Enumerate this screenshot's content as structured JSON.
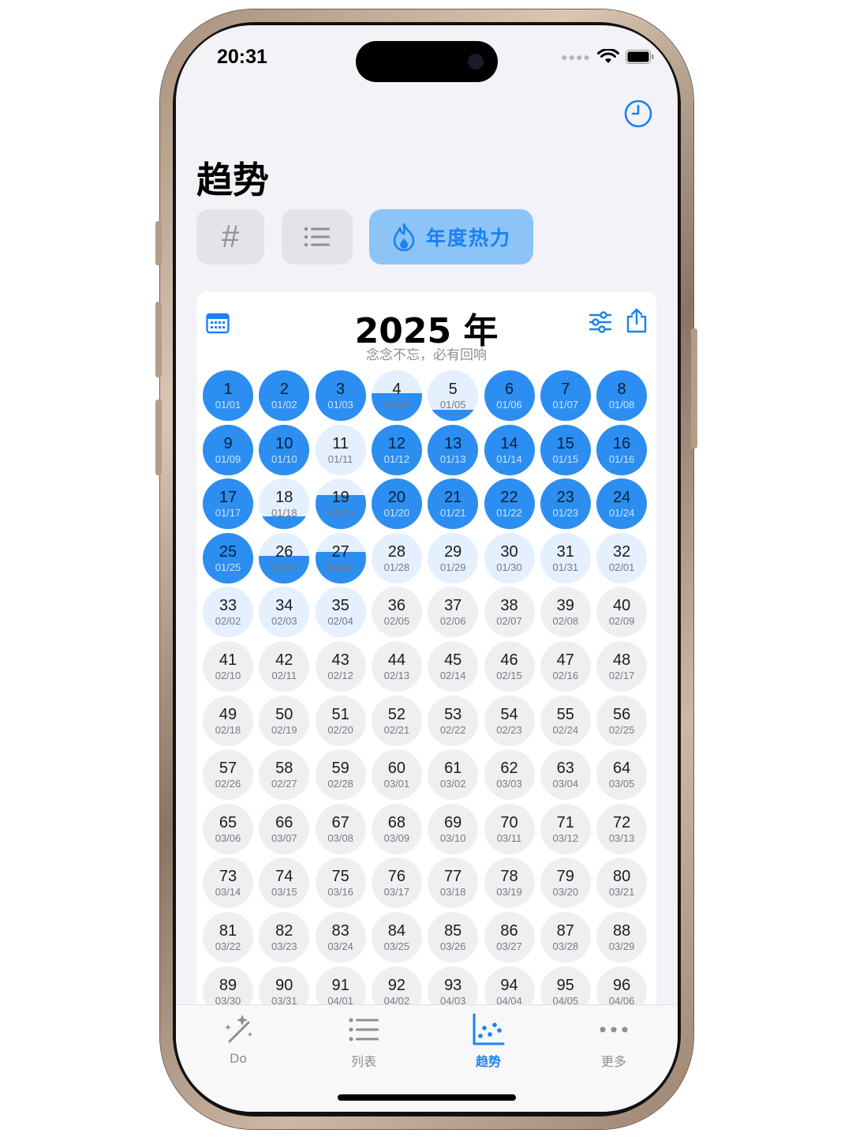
{
  "status": {
    "time": "20:31"
  },
  "page": {
    "title": "趋势"
  },
  "segments": {
    "hash_label": "#",
    "heat_label": "年度热力"
  },
  "card": {
    "year": "2025 年",
    "subtitle": "念念不忘，必有回响"
  },
  "colors": {
    "accent": "#2b8ef0",
    "accent_light": "#e4f0fd",
    "segment_active": "#8cc4f7",
    "future": "#efeff2"
  },
  "days": [
    {
      "n": "1",
      "d": "01/01",
      "fill": 1
    },
    {
      "n": "2",
      "d": "01/02",
      "fill": 1
    },
    {
      "n": "3",
      "d": "01/03",
      "fill": 1
    },
    {
      "n": "4",
      "d": "01/04",
      "fill": 0.55
    },
    {
      "n": "5",
      "d": "01/05",
      "fill": 0.22
    },
    {
      "n": "6",
      "d": "01/06",
      "fill": 1
    },
    {
      "n": "7",
      "d": "01/07",
      "fill": 1
    },
    {
      "n": "8",
      "d": "01/08",
      "fill": 1
    },
    {
      "n": "9",
      "d": "01/09",
      "fill": 1
    },
    {
      "n": "10",
      "d": "01/10",
      "fill": 1
    },
    {
      "n": "11",
      "d": "01/11",
      "fill": 0
    },
    {
      "n": "12",
      "d": "01/12",
      "fill": 1
    },
    {
      "n": "13",
      "d": "01/13",
      "fill": 1
    },
    {
      "n": "14",
      "d": "01/14",
      "fill": 1
    },
    {
      "n": "15",
      "d": "01/15",
      "fill": 1
    },
    {
      "n": "16",
      "d": "01/16",
      "fill": 1
    },
    {
      "n": "17",
      "d": "01/17",
      "fill": 1
    },
    {
      "n": "18",
      "d": "01/18",
      "fill": 0.25
    },
    {
      "n": "19",
      "d": "01/19",
      "fill": 0.68
    },
    {
      "n": "20",
      "d": "01/20",
      "fill": 1
    },
    {
      "n": "21",
      "d": "01/21",
      "fill": 1
    },
    {
      "n": "22",
      "d": "01/22",
      "fill": 1
    },
    {
      "n": "23",
      "d": "01/23",
      "fill": 1
    },
    {
      "n": "24",
      "d": "01/24",
      "fill": 1
    },
    {
      "n": "25",
      "d": "01/25",
      "fill": 1
    },
    {
      "n": "26",
      "d": "01/26",
      "fill": 0.55
    },
    {
      "n": "27",
      "d": "01/27",
      "fill": 0.62
    },
    {
      "n": "28",
      "d": "01/28",
      "fill": 0
    },
    {
      "n": "29",
      "d": "01/29",
      "fill": 0
    },
    {
      "n": "30",
      "d": "01/30",
      "fill": 0
    },
    {
      "n": "31",
      "d": "01/31",
      "fill": 0
    },
    {
      "n": "32",
      "d": "02/01",
      "fill": 0
    },
    {
      "n": "33",
      "d": "02/02",
      "fill": 0
    },
    {
      "n": "34",
      "d": "02/03",
      "fill": 0
    },
    {
      "n": "35",
      "d": "02/04",
      "fill": 0
    },
    {
      "n": "36",
      "d": "02/05"
    },
    {
      "n": "37",
      "d": "02/06"
    },
    {
      "n": "38",
      "d": "02/07"
    },
    {
      "n": "39",
      "d": "02/08"
    },
    {
      "n": "40",
      "d": "02/09"
    },
    {
      "n": "41",
      "d": "02/10"
    },
    {
      "n": "42",
      "d": "02/11"
    },
    {
      "n": "43",
      "d": "02/12"
    },
    {
      "n": "44",
      "d": "02/13"
    },
    {
      "n": "45",
      "d": "02/14"
    },
    {
      "n": "46",
      "d": "02/15"
    },
    {
      "n": "47",
      "d": "02/16"
    },
    {
      "n": "48",
      "d": "02/17"
    },
    {
      "n": "49",
      "d": "02/18"
    },
    {
      "n": "50",
      "d": "02/19"
    },
    {
      "n": "51",
      "d": "02/20"
    },
    {
      "n": "52",
      "d": "02/21"
    },
    {
      "n": "53",
      "d": "02/22"
    },
    {
      "n": "54",
      "d": "02/23"
    },
    {
      "n": "55",
      "d": "02/24"
    },
    {
      "n": "56",
      "d": "02/25"
    },
    {
      "n": "57",
      "d": "02/26"
    },
    {
      "n": "58",
      "d": "02/27"
    },
    {
      "n": "59",
      "d": "02/28"
    },
    {
      "n": "60",
      "d": "03/01"
    },
    {
      "n": "61",
      "d": "03/02"
    },
    {
      "n": "62",
      "d": "03/03"
    },
    {
      "n": "63",
      "d": "03/04"
    },
    {
      "n": "64",
      "d": "03/05"
    },
    {
      "n": "65",
      "d": "03/06"
    },
    {
      "n": "66",
      "d": "03/07"
    },
    {
      "n": "67",
      "d": "03/08"
    },
    {
      "n": "68",
      "d": "03/09"
    },
    {
      "n": "69",
      "d": "03/10"
    },
    {
      "n": "70",
      "d": "03/11"
    },
    {
      "n": "71",
      "d": "03/12"
    },
    {
      "n": "72",
      "d": "03/13"
    },
    {
      "n": "73",
      "d": "03/14"
    },
    {
      "n": "74",
      "d": "03/15"
    },
    {
      "n": "75",
      "d": "03/16"
    },
    {
      "n": "76",
      "d": "03/17"
    },
    {
      "n": "77",
      "d": "03/18"
    },
    {
      "n": "78",
      "d": "03/19"
    },
    {
      "n": "79",
      "d": "03/20"
    },
    {
      "n": "80",
      "d": "03/21"
    },
    {
      "n": "81",
      "d": "03/22"
    },
    {
      "n": "82",
      "d": "03/23"
    },
    {
      "n": "83",
      "d": "03/24"
    },
    {
      "n": "84",
      "d": "03/25"
    },
    {
      "n": "85",
      "d": "03/26"
    },
    {
      "n": "86",
      "d": "03/27"
    },
    {
      "n": "87",
      "d": "03/28"
    },
    {
      "n": "88",
      "d": "03/29"
    },
    {
      "n": "89",
      "d": "03/30"
    },
    {
      "n": "90",
      "d": "03/31"
    },
    {
      "n": "91",
      "d": "04/01"
    },
    {
      "n": "92",
      "d": "04/02"
    },
    {
      "n": "93",
      "d": "04/03"
    },
    {
      "n": "94",
      "d": "04/04"
    },
    {
      "n": "95",
      "d": "04/05"
    },
    {
      "n": "96",
      "d": "04/06"
    }
  ],
  "tabs": [
    {
      "label": "Do",
      "icon": "magic-wand-icon"
    },
    {
      "label": "列表",
      "icon": "list-icon"
    },
    {
      "label": "趋势",
      "icon": "scatter-chart-icon",
      "active": true
    },
    {
      "label": "更多",
      "icon": "more-icon"
    }
  ]
}
